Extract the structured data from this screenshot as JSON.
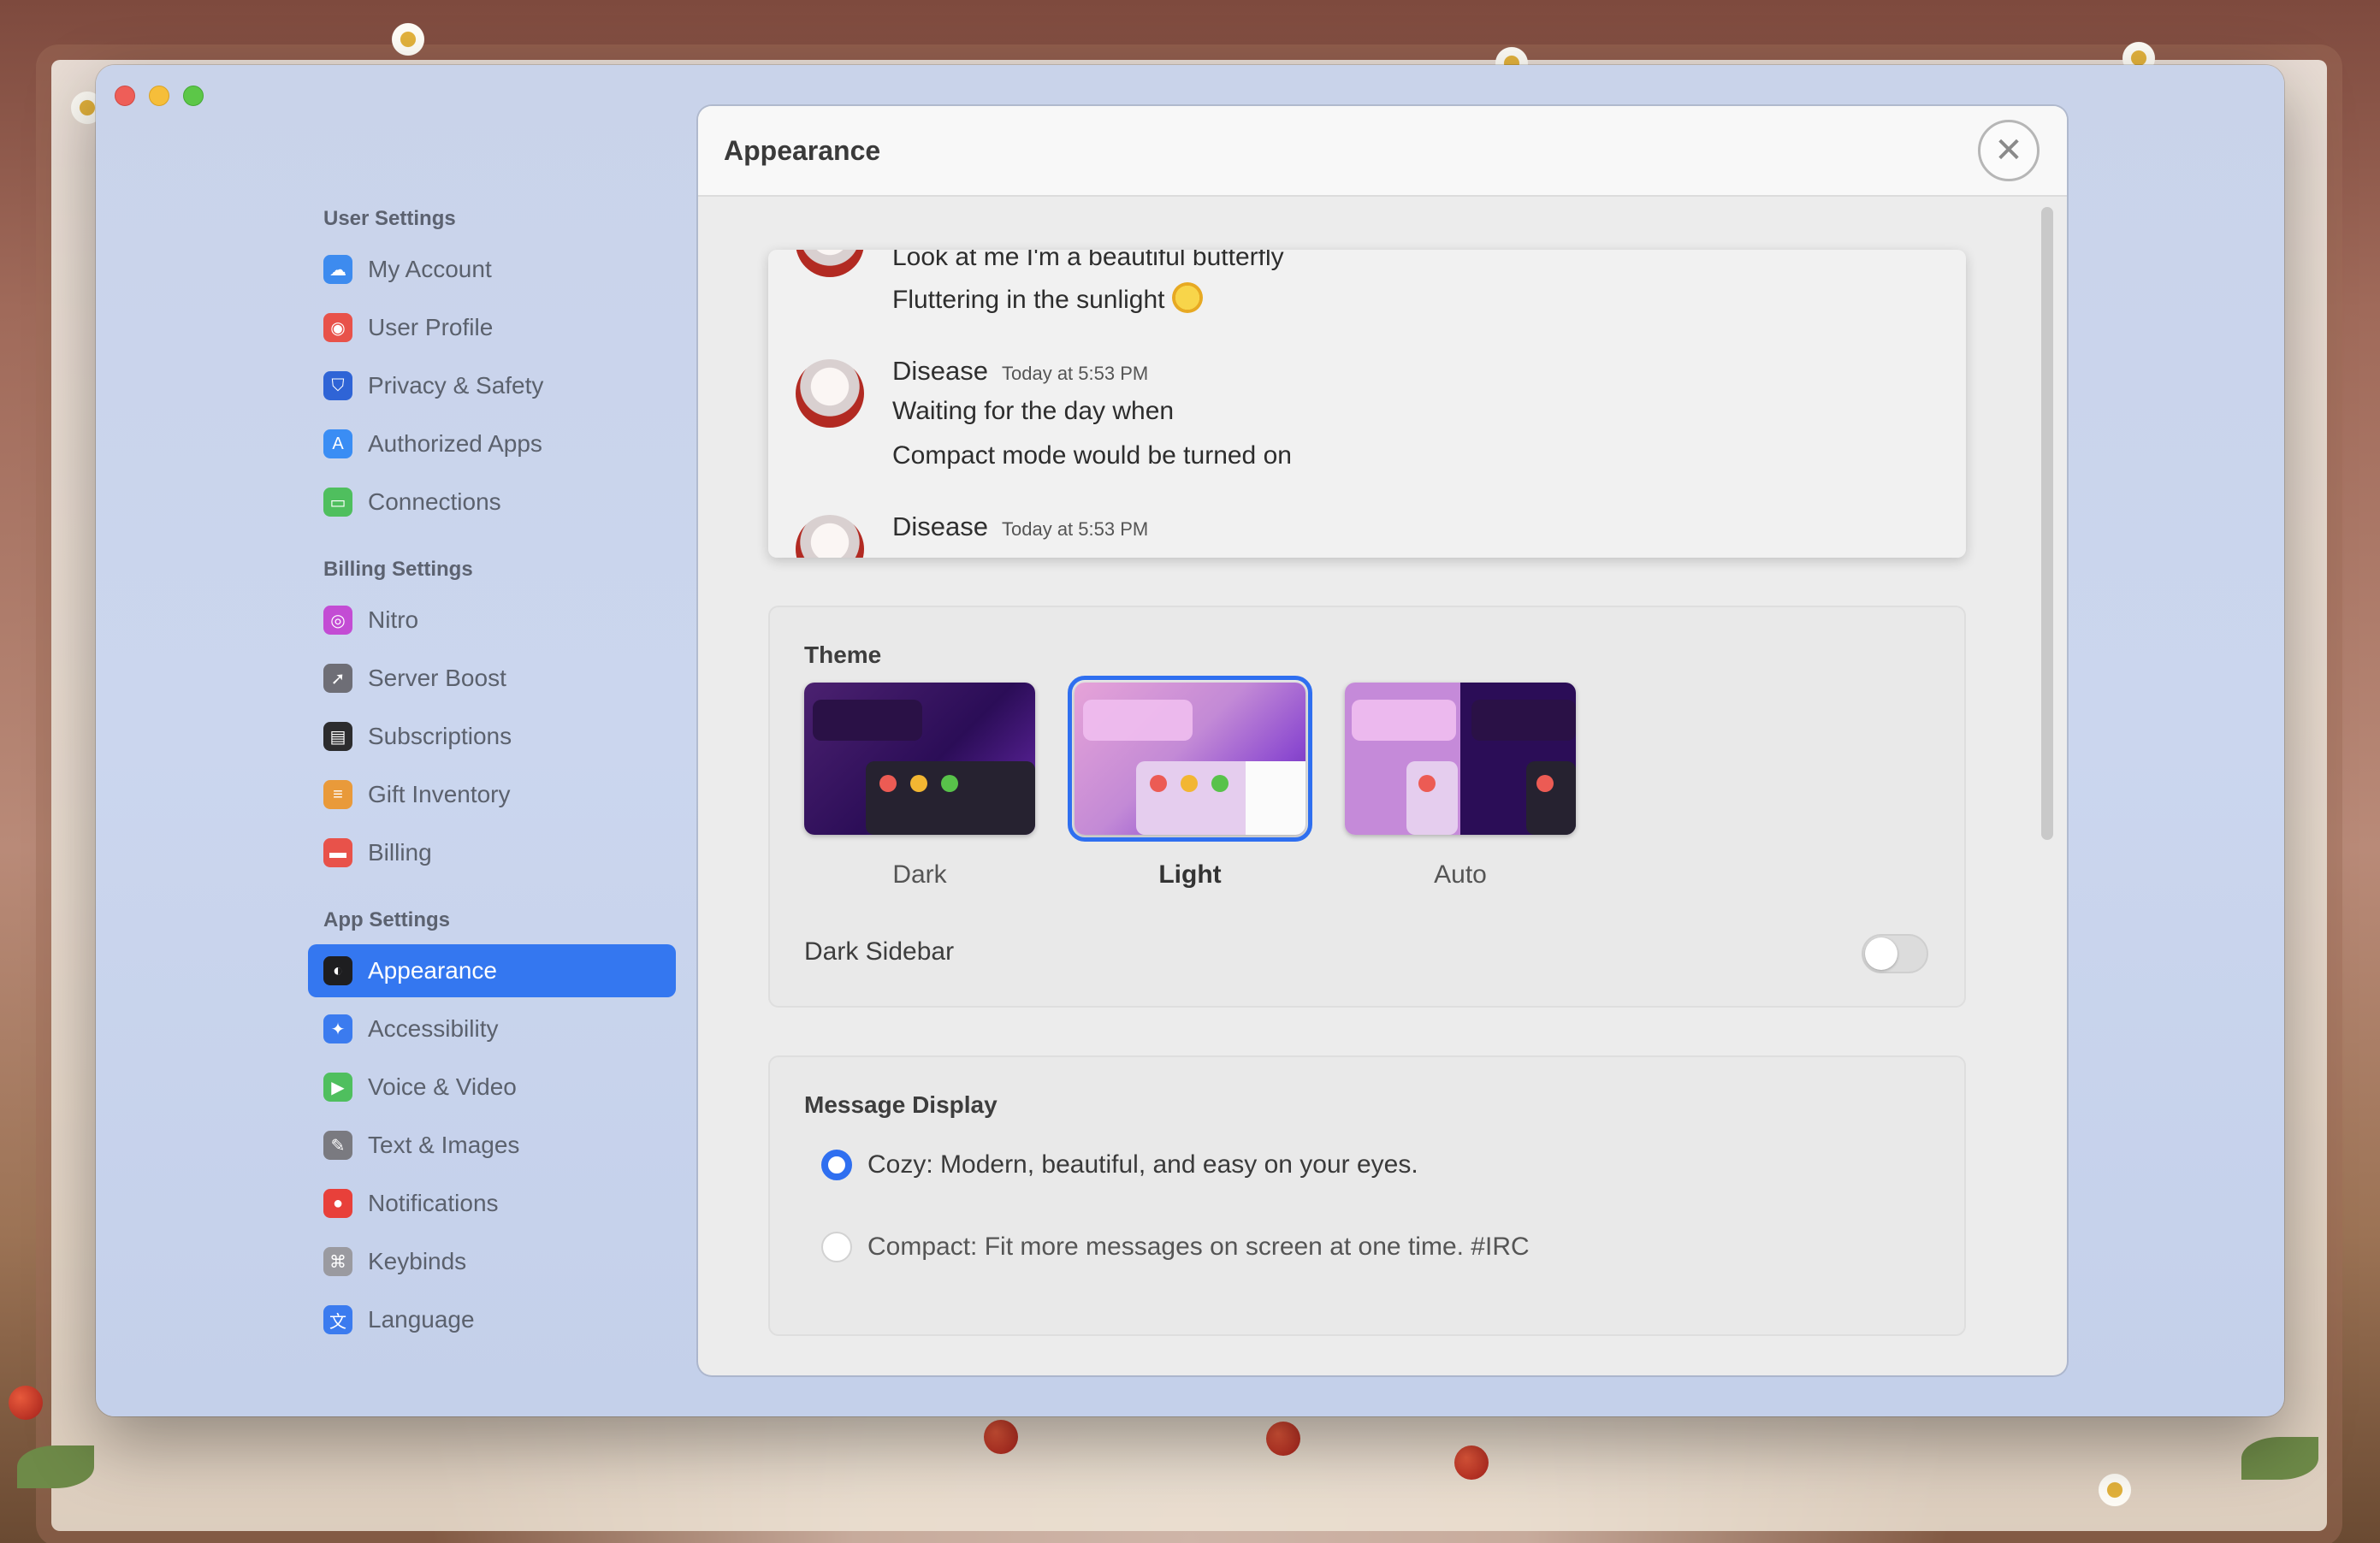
{
  "window_controls": [
    "close",
    "minimize",
    "maximize"
  ],
  "sidebar": {
    "groups": [
      {
        "header": "User Settings",
        "items": [
          {
            "label": "My Account",
            "icon": "cloud-icon",
            "color": "#3d8bef"
          },
          {
            "label": "User Profile",
            "icon": "profile-icon",
            "color": "#e8524a"
          },
          {
            "label": "Privacy & Safety",
            "icon": "shield-icon",
            "color": "#2f64d6"
          },
          {
            "label": "Authorized Apps",
            "icon": "app-store-icon",
            "color": "#3a8df4"
          },
          {
            "label": "Connections",
            "icon": "connections-icon",
            "color": "#4fbf5e"
          }
        ]
      },
      {
        "header": "Billing Settings",
        "items": [
          {
            "label": "Nitro",
            "icon": "nitro-icon",
            "color": "#c34cd4"
          },
          {
            "label": "Server Boost",
            "icon": "rocket-icon",
            "color": "#6e6e76"
          },
          {
            "label": "Subscriptions",
            "icon": "wallet-icon",
            "color": "#2c2c2e"
          },
          {
            "label": "Gift Inventory",
            "icon": "gift-stack-icon",
            "color": "#e99a3a"
          },
          {
            "label": "Billing",
            "icon": "billing-icon",
            "color": "#e8524a"
          }
        ]
      },
      {
        "header": "App Settings",
        "items": [
          {
            "label": "Appearance",
            "icon": "appearance-icon",
            "color": "#1e1e20",
            "active": true
          },
          {
            "label": "Accessibility",
            "icon": "accessibility-icon",
            "color": "#3b7bef"
          },
          {
            "label": "Voice & Video",
            "icon": "facetime-icon",
            "color": "#4fbf5e"
          },
          {
            "label": "Text & Images",
            "icon": "text-edit-icon",
            "color": "#7a7a80"
          },
          {
            "label": "Notifications",
            "icon": "notifications-icon",
            "color": "#e8403a"
          },
          {
            "label": "Keybinds",
            "icon": "command-key-icon",
            "color": "#9a9aa0"
          },
          {
            "label": "Language",
            "icon": "translate-icon",
            "color": "#3b7bef"
          }
        ]
      }
    ]
  },
  "panel": {
    "title": "Appearance",
    "close_icon": "close-icon",
    "preview": {
      "top_line_1": "Look at me I'm a beautiful butterfly",
      "top_line_2": "Fluttering in the sunlight",
      "message_1": {
        "author": "Disease",
        "time": "Today at 5:53 PM",
        "line_1": "Waiting for the day when",
        "line_2": "Compact mode would be turned on"
      },
      "message_2": {
        "author": "Disease",
        "time": "Today at 5:53 PM"
      }
    },
    "theme": {
      "title": "Theme",
      "options": [
        {
          "label": "Dark"
        },
        {
          "label": "Light",
          "selected": true
        },
        {
          "label": "Auto"
        }
      ],
      "dark_sidebar_label": "Dark Sidebar",
      "dark_sidebar_on": false
    },
    "message_display": {
      "title": "Message Display",
      "options": [
        {
          "label": "Cozy: Modern, beautiful, and easy on your eyes.",
          "checked": true
        },
        {
          "label": "Compact: Fit more messages on screen at one time. #IRC",
          "checked": false
        }
      ]
    }
  },
  "colors": {
    "accent": "#3477f0",
    "selected_radio": "#2f6ff0"
  }
}
